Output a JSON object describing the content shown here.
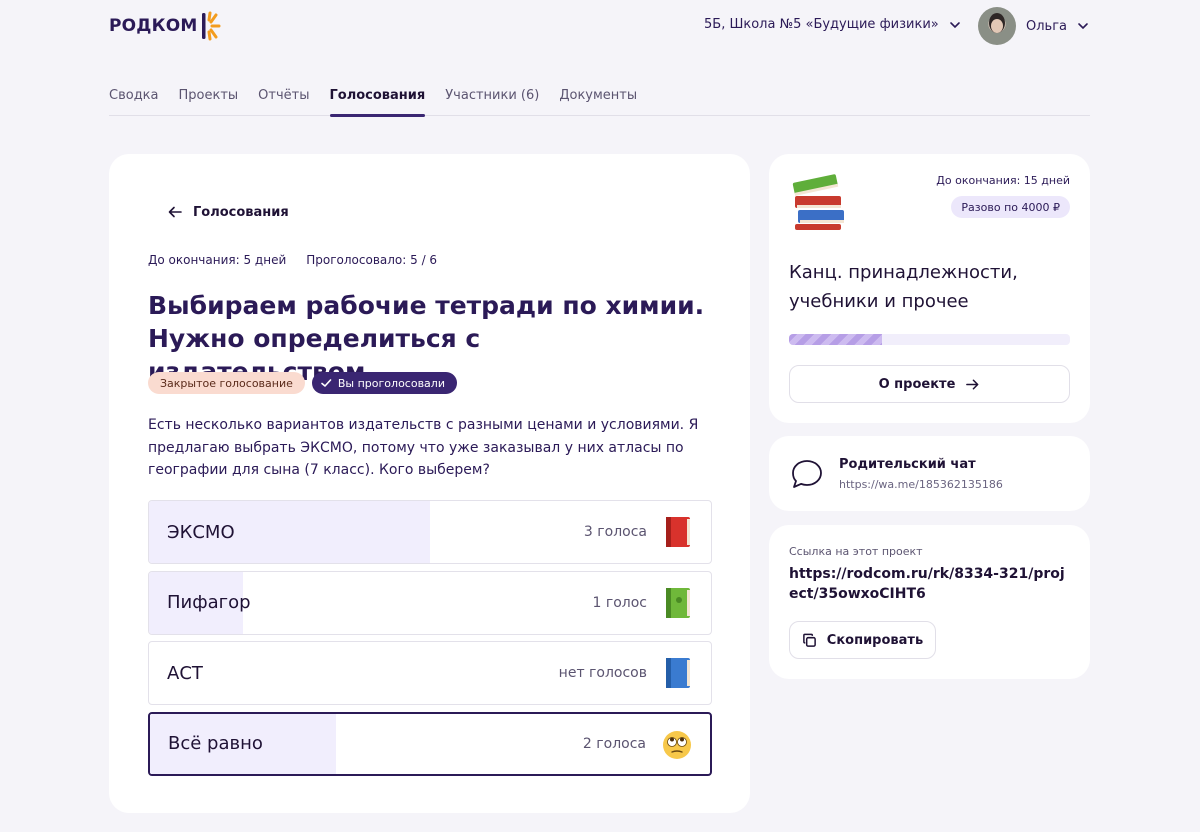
{
  "header": {
    "logo_text": "РОДКОМ",
    "school_selector": "5Б, Школа №5 «Будущие физики»",
    "user_name": "Ольга"
  },
  "tabs": [
    {
      "label": "Сводка",
      "active": false
    },
    {
      "label": "Проекты",
      "active": false
    },
    {
      "label": "Отчёты",
      "active": false
    },
    {
      "label": "Голосования",
      "active": true
    },
    {
      "label": "Участники (6)",
      "active": false
    },
    {
      "label": "Документы",
      "active": false
    }
  ],
  "poll": {
    "back_label": "Голосования",
    "deadline": "До окончания: 5 дней",
    "voted_count": "Проголосовало: 5 / 6",
    "title": "Выбираем рабочие тетради по химии. Нужно определиться с издательством.",
    "badge_closed": "Закрытое голосование",
    "badge_voted": "Вы проголосовали",
    "description": "Есть несколько вариантов издательств с разными ценами и условиями. Я предлагаю выбрать ЭКСМО, потому что уже заказывал у них атласы по географии для сына (7 класс). Кого выберем?",
    "options": [
      {
        "label": "ЭКСМО",
        "votes_text": "3 голоса",
        "votes": 3,
        "icon": "red-book-icon",
        "color": "#d8322c",
        "selected": false
      },
      {
        "label": "Пифагор",
        "votes_text": "1 голос",
        "votes": 1,
        "icon": "green-book-icon",
        "color": "#6fb83a",
        "selected": false
      },
      {
        "label": "АСТ",
        "votes_text": "нет голосов",
        "votes": 0,
        "icon": "blue-book-icon",
        "color": "#3a7bd0",
        "selected": false
      },
      {
        "label": "Всё равно",
        "votes_text": "2 голоса",
        "votes": 2,
        "icon": "eye-roll-emoji-icon",
        "color": "#f7c84a",
        "selected": true
      }
    ],
    "vote_share_of_max": [
      0.5,
      0.167,
      0,
      0.333
    ]
  },
  "project": {
    "deadline": "До окончания: 15 дней",
    "price": "Разово по 4000 ₽",
    "title": "Канц. принадлежности, учебники и прочее",
    "progress": 0.33,
    "about_label": "О проекте"
  },
  "chat": {
    "title": "Родительский чат",
    "link": "https://wa.me/185362135186"
  },
  "share": {
    "caption": "Ссылка на этот проект",
    "url": "https://rodcom.ru/rk/8334-321/project/35owxoCIHT6",
    "copy_label": "Скопировать"
  },
  "colors": {
    "accent": "#3a2672",
    "logo_orange": "#f39c1e",
    "badge_closed_bg": "#fadbd0",
    "fill": "#f1eefd"
  }
}
